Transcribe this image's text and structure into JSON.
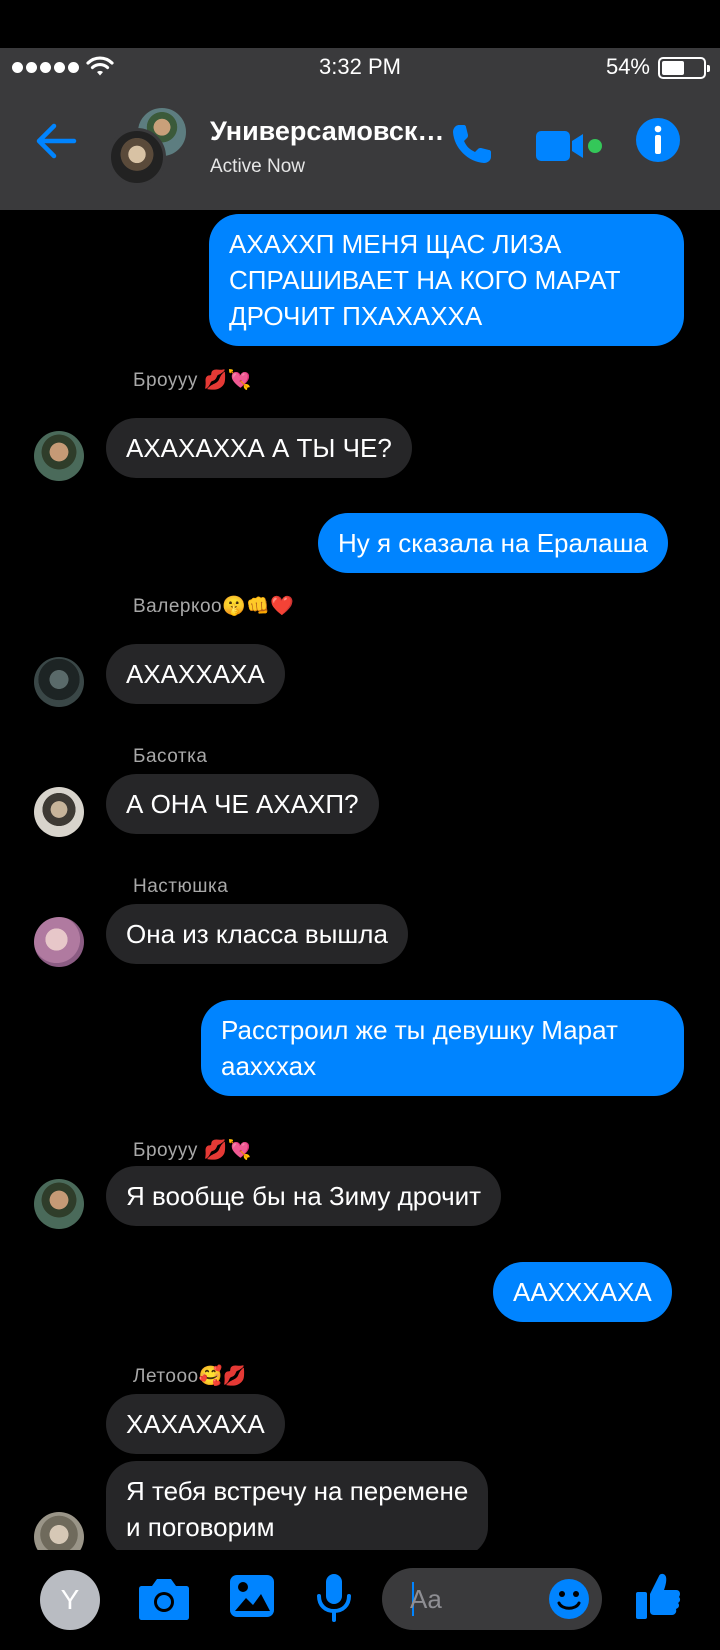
{
  "status_bar": {
    "time": "3:32 PM",
    "battery_percent": "54%",
    "battery_level": 0.54,
    "signal_bars": 5
  },
  "header": {
    "title": "Универсамовская",
    "status": "Active Now",
    "back_icon": "arrow-left-icon",
    "call_icon": "phone-icon",
    "video_icon": "video-camera-icon",
    "info_icon": "info-icon"
  },
  "colors": {
    "accent": "#0084ff",
    "header_bg": "#3a3a3c",
    "incoming_bubble": "#262628",
    "online": "#34c759"
  },
  "messages": [
    {
      "direction": "out",
      "text": [
        "АХАХХП МЕНЯ ЩАС ЛИЗА",
        "СПРАШИВАЕТ НА КОГО МАРАТ",
        "ДРОЧИТ ПХАХАХХА"
      ]
    },
    {
      "direction": "in",
      "sender": "Броууу 💋💘",
      "text": [
        "АХАХАХХА А ТЫ ЧЕ?"
      ]
    },
    {
      "direction": "out",
      "text": [
        "Ну я сказала на Ералаша"
      ]
    },
    {
      "direction": "in",
      "sender": "Валеркоо🤫👊❤️",
      "text": [
        "АХАХХАХА"
      ]
    },
    {
      "direction": "in",
      "sender": "Басотка",
      "text": [
        "А ОНА ЧЕ АХАХП?"
      ]
    },
    {
      "direction": "in",
      "sender": "Настюшка",
      "text": [
        "Она из класса вышла"
      ]
    },
    {
      "direction": "out",
      "text": [
        "Расстроил же ты девушку Марат",
        "аахххах"
      ]
    },
    {
      "direction": "in",
      "sender": "Броууу 💋💘",
      "text": [
        "Я вообще бы на Зиму дрочит"
      ]
    },
    {
      "direction": "out",
      "text": [
        "ААХХХАХА"
      ]
    },
    {
      "direction": "in",
      "sender": "Летооо🥰💋",
      "text": [
        "ХАХАХАХА"
      ]
    },
    {
      "direction": "in",
      "text": [
        "Я тебя встречу на перемене",
        "и поговорим"
      ]
    }
  ],
  "composer": {
    "me_initial": "Y",
    "placeholder": "Aa",
    "camera_icon": "camera-icon",
    "gallery_icon": "image-icon",
    "mic_icon": "microphone-icon",
    "emoji_icon": "smiley-icon",
    "like_icon": "thumbs-up-icon"
  }
}
